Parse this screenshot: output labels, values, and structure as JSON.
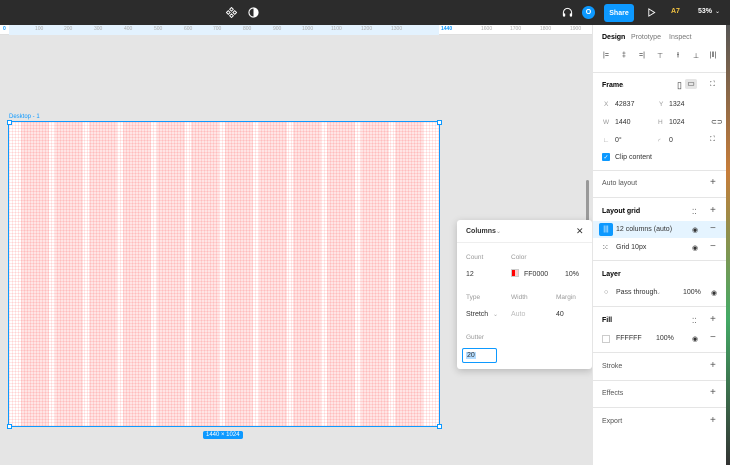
{
  "toolbar": {
    "avatar_initial": "O",
    "share_label": "Share",
    "a7_label": "A7",
    "zoom_label": "53%"
  },
  "ruler": {
    "ticks": [
      "0",
      "100",
      "200",
      "300",
      "400",
      "500",
      "600",
      "700",
      "800",
      "900",
      "1000",
      "1100",
      "1200",
      "1300",
      "1440",
      "1600",
      "1700",
      "1800",
      "1900"
    ]
  },
  "canvas": {
    "frame_label": "Desktop - 1",
    "size_badge": "1440 × 1024"
  },
  "popup": {
    "title": "Columns",
    "count_label": "Count",
    "count_value": "12",
    "color_label": "Color",
    "color_value": "FF0000",
    "opacity_value": "10%",
    "type_label": "Type",
    "type_value": "Stretch",
    "width_label": "Width",
    "width_value": "Auto",
    "margin_label": "Margin",
    "margin_value": "40",
    "gutter_label": "Gutter",
    "gutter_value": "20",
    "accent": "#0d99ff",
    "grid_color": "#ff0000"
  },
  "panel": {
    "tabs": [
      "Design",
      "Prototype",
      "Inspect"
    ],
    "frame": {
      "title": "Frame",
      "x_label": "X",
      "x_value": "42837",
      "y_label": "Y",
      "y_value": "1324",
      "w_label": "W",
      "w_value": "1440",
      "h_label": "H",
      "h_value": "1024",
      "rotation_value": "0°",
      "radius_value": "0",
      "clip_label": "Clip content"
    },
    "auto_layout_title": "Auto layout",
    "layout_grid": {
      "title": "Layout grid",
      "items": [
        {
          "label": "12 columns (auto)"
        },
        {
          "label": "Grid 10px"
        }
      ]
    },
    "layer": {
      "title": "Layer",
      "blend": "Pass through",
      "opacity": "100%"
    },
    "fill": {
      "title": "Fill",
      "hex": "FFFFFF",
      "opacity": "100%"
    },
    "stroke_title": "Stroke",
    "effects_title": "Effects",
    "export_title": "Export"
  }
}
